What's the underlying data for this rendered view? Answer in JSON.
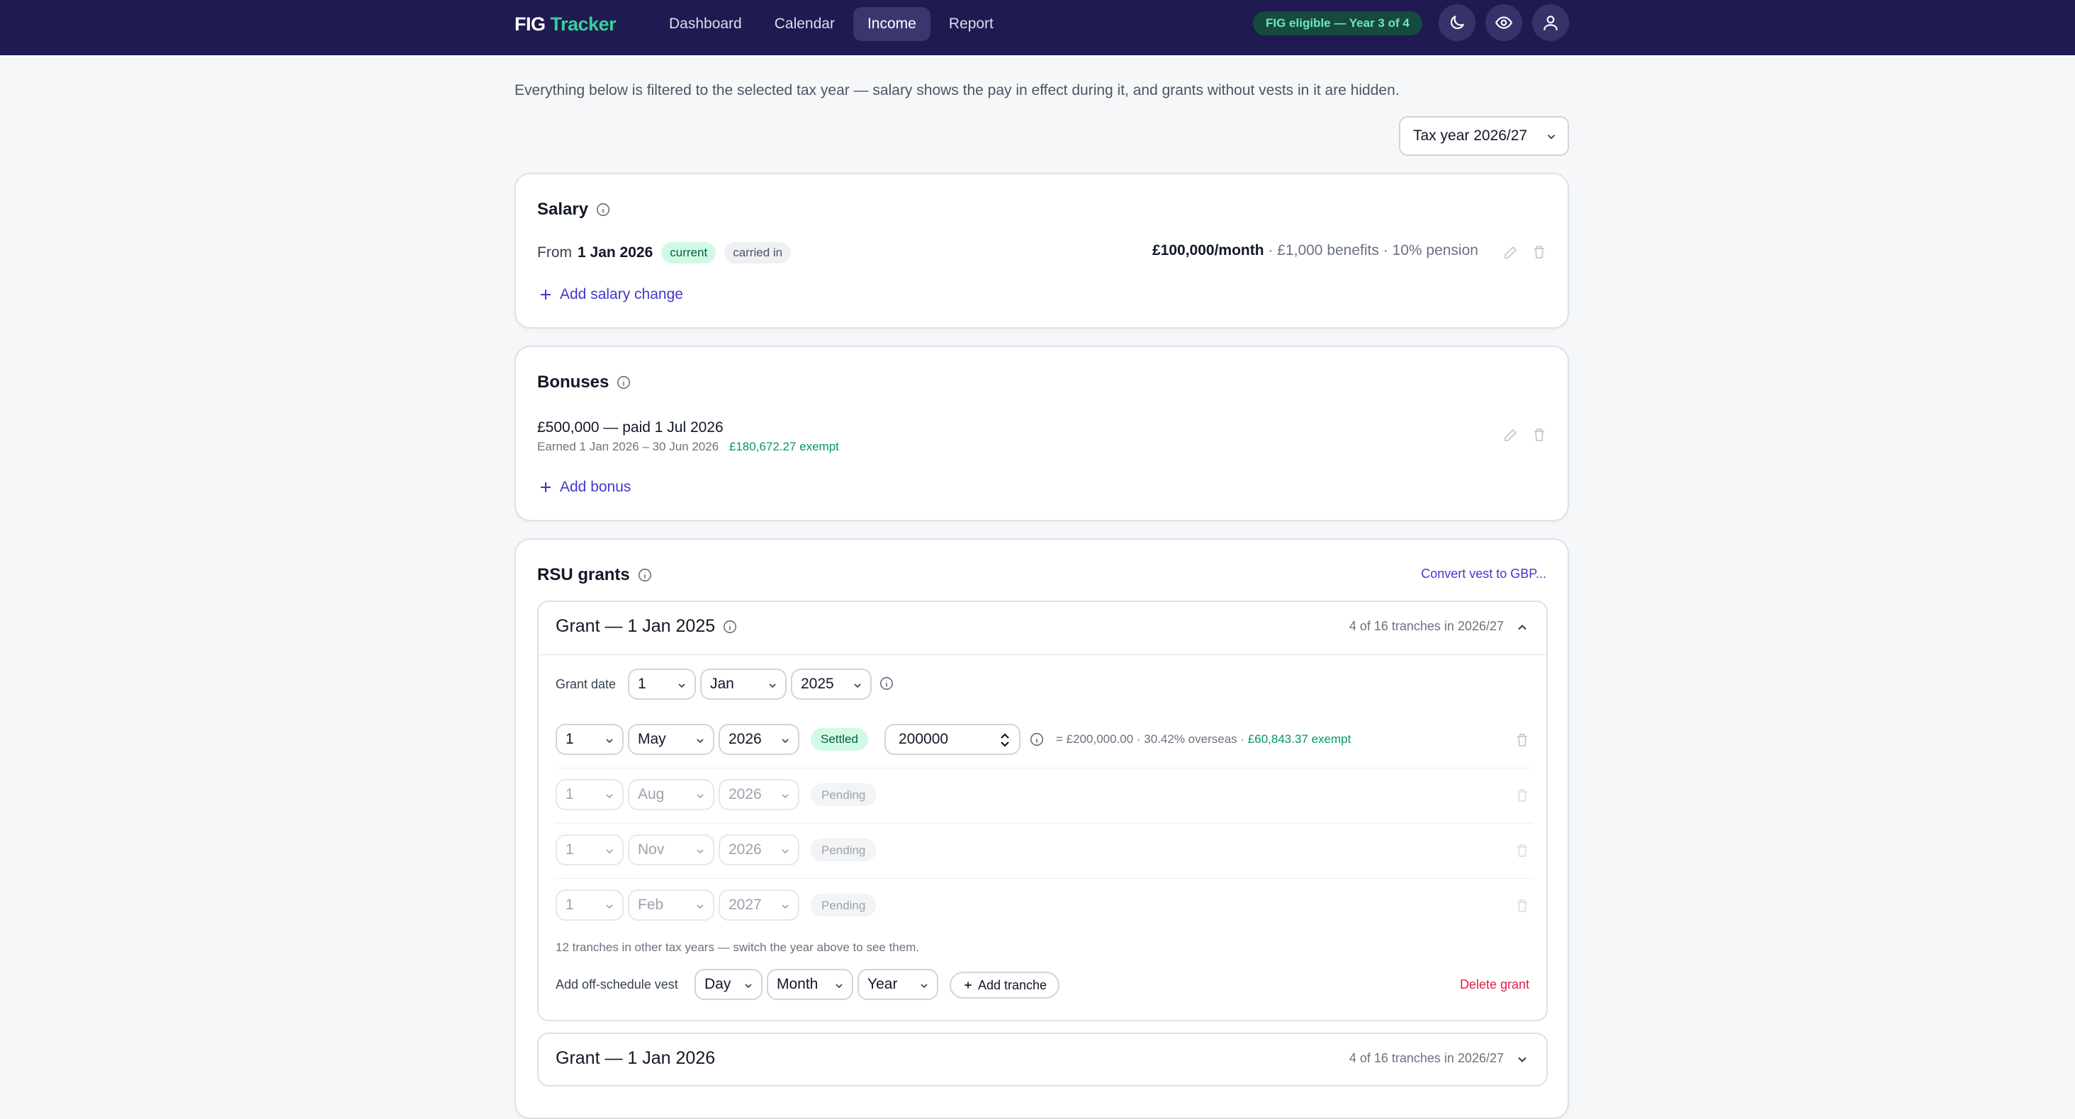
{
  "nav": {
    "logo_main": "FIG",
    "logo_accent": "Tracker",
    "items": [
      "Dashboard",
      "Calendar",
      "Income",
      "Report"
    ],
    "active": "Income",
    "badge": "FIG eligible — Year 3 of 4"
  },
  "intro": "Everything below is filtered to the selected tax year — salary shows the pay in effect during it, and grants without vests in it are hidden.",
  "tax_year": "Tax year 2026/27",
  "salary": {
    "title": "Salary",
    "from_prefix": "From",
    "from_date": "1 Jan 2026",
    "tag_current": "current",
    "tag_carried": "carried in",
    "amount": "£100,000/month",
    "details": "· £1,000 benefits · 10% pension",
    "add": "Add salary change"
  },
  "bonuses": {
    "title": "Bonuses",
    "item_main": "£500,000 — paid 1 Jul 2026",
    "item_earned": "Earned 1 Jan 2026 – 30 Jun 2026",
    "item_exempt": "£180,672.27 exempt",
    "add": "Add bonus"
  },
  "rsu": {
    "title": "RSU grants",
    "convert": "Convert vest to GBP...",
    "grant1": {
      "title": "Grant — 1 Jan 2025",
      "meta": "4 of 16 tranches in 2026/27",
      "grant_date_label": "Grant date",
      "grant_day": "1",
      "grant_month": "Jan",
      "grant_year": "2025",
      "tranches": [
        {
          "day": "1",
          "month": "May",
          "year": "2026",
          "status": "Settled",
          "qty": "200000",
          "calc": "= £200,000.00 · 30.42% overseas ·",
          "exempt": "£60,843.37 exempt"
        },
        {
          "day": "1",
          "month": "Aug",
          "year": "2026",
          "status": "Pending"
        },
        {
          "day": "1",
          "month": "Nov",
          "year": "2026",
          "status": "Pending"
        },
        {
          "day": "1",
          "month": "Feb",
          "year": "2027",
          "status": "Pending"
        }
      ],
      "other_note": "12 tranches in other tax years — switch the year above to see them.",
      "offsched_label": "Add off-schedule vest",
      "off_day": "Day",
      "off_month": "Month",
      "off_year": "Year",
      "add_tranche": "Add tranche",
      "delete": "Delete grant"
    },
    "grant2": {
      "title": "Grant — 1 Jan 2026",
      "meta": "4 of 16 tranches in 2026/27"
    }
  },
  "colors": {
    "nav_bg": "#1f1a4f",
    "accent_green": "#34d399",
    "link_purple": "#4338ca",
    "exempt_green": "#059669",
    "delete_red": "#e11d48"
  }
}
